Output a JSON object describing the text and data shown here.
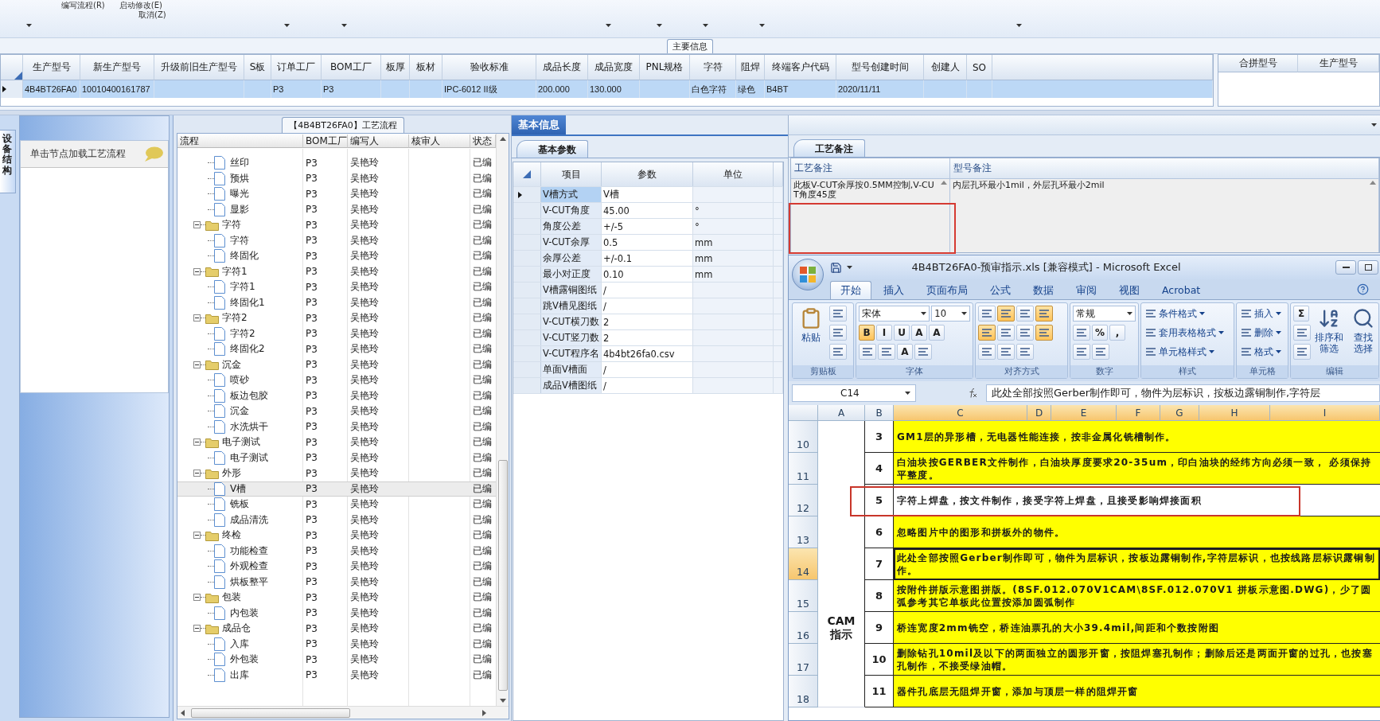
{
  "toolbar": {
    "menu_items": [
      "编写流程(R)",
      "启动修改(E)",
      "取消(Z)"
    ]
  },
  "main_info": {
    "title": "主要信息",
    "columns": [
      {
        "label": "生产型号",
        "value": "4B4BT26FA0"
      },
      {
        "label": "新生产型号",
        "value": "10010400161787"
      },
      {
        "label": "升级前旧生产型号"
      },
      {
        "label": "S板"
      },
      {
        "label": "订单工厂",
        "value": "P3"
      },
      {
        "label": "BOM工厂",
        "value": "P3"
      },
      {
        "label": "板厚"
      },
      {
        "label": "板材"
      },
      {
        "label": "验收标准",
        "value": "IPC-6012 II级"
      },
      {
        "label": "成品长度",
        "value": "200.000"
      },
      {
        "label": "成品宽度",
        "value": "130.000"
      },
      {
        "label": "PNL规格"
      },
      {
        "label": "字符",
        "value": "白色字符"
      },
      {
        "label": "阻焊",
        "value": "绿色"
      },
      {
        "label": "终端客户代码",
        "value": "B4BT"
      },
      {
        "label": "型号创建时间",
        "value": "2020/11/11"
      },
      {
        "label": "创建人"
      },
      {
        "label": "SO"
      }
    ],
    "right_columns": [
      "合拼型号",
      "生产型号"
    ]
  },
  "nav_panel": {
    "tab": "设备结构",
    "hint": "单击节点加载工艺流程"
  },
  "process_tree": {
    "title": "【4B4BT26FA0】工艺流程",
    "columns": [
      "流程",
      "BOM工厂",
      "编写人",
      "核审人",
      "状态"
    ],
    "nodes": [
      {
        "label": "丝印",
        "kind": "file",
        "bom": "P3",
        "author": "吴艳玲",
        "status": "已编",
        "selected": false
      },
      {
        "label": "预烘",
        "kind": "file",
        "bom": "P3",
        "author": "吴艳玲",
        "status": "已编",
        "selected": false
      },
      {
        "label": "曝光",
        "kind": "file",
        "bom": "P3",
        "author": "吴艳玲",
        "status": "已编",
        "selected": false
      },
      {
        "label": "显影",
        "kind": "file",
        "bom": "P3",
        "author": "吴艳玲",
        "status": "已编",
        "selected": false
      },
      {
        "label": "字符",
        "kind": "folder",
        "expanded": true,
        "bom": "P3",
        "author": "吴艳玲",
        "status": "已编",
        "selected": false,
        "children": [
          {
            "label": "字符",
            "kind": "file",
            "bom": "P3",
            "author": "吴艳玲",
            "status": "已编",
            "selected": false
          },
          {
            "label": "终固化",
            "kind": "file",
            "bom": "P3",
            "author": "吴艳玲",
            "status": "已编",
            "selected": false
          }
        ]
      },
      {
        "label": "字符1",
        "kind": "folder",
        "expanded": true,
        "bom": "P3",
        "author": "吴艳玲",
        "status": "已编",
        "selected": false,
        "children": [
          {
            "label": "字符1",
            "kind": "file",
            "bom": "P3",
            "author": "吴艳玲",
            "status": "已编",
            "selected": false
          },
          {
            "label": "终固化1",
            "kind": "file",
            "bom": "P3",
            "author": "吴艳玲",
            "status": "已编",
            "selected": false
          }
        ]
      },
      {
        "label": "字符2",
        "kind": "folder",
        "expanded": true,
        "bom": "P3",
        "author": "吴艳玲",
        "status": "已编",
        "selected": false,
        "children": [
          {
            "label": "字符2",
            "kind": "file",
            "bom": "P3",
            "author": "吴艳玲",
            "status": "已编",
            "selected": false
          },
          {
            "label": "终固化2",
            "kind": "file",
            "bom": "P3",
            "author": "吴艳玲",
            "status": "已编",
            "selected": false
          }
        ]
      },
      {
        "label": "沉金",
        "kind": "folder",
        "expanded": true,
        "bom": "P3",
        "author": "吴艳玲",
        "status": "已编",
        "selected": false,
        "children": [
          {
            "label": "喷砂",
            "kind": "file",
            "bom": "P3",
            "author": "吴艳玲",
            "status": "已编",
            "selected": false
          },
          {
            "label": "板边包胶",
            "kind": "file",
            "bom": "P3",
            "author": "吴艳玲",
            "status": "已编",
            "selected": false
          },
          {
            "label": "沉金",
            "kind": "file",
            "bom": "P3",
            "author": "吴艳玲",
            "status": "已编",
            "selected": false
          },
          {
            "label": "水洗烘干",
            "kind": "file",
            "bom": "P3",
            "author": "吴艳玲",
            "status": "已编",
            "selected": false
          }
        ]
      },
      {
        "label": "电子测试",
        "kind": "folder",
        "expanded": true,
        "bom": "P3",
        "author": "吴艳玲",
        "status": "已编",
        "selected": false,
        "children": [
          {
            "label": "电子测试",
            "kind": "file",
            "bom": "P3",
            "author": "吴艳玲",
            "status": "已编",
            "selected": false
          }
        ]
      },
      {
        "label": "外形",
        "kind": "folder",
        "expanded": true,
        "bom": "P3",
        "author": "吴艳玲",
        "status": "已编",
        "selected": false,
        "children": [
          {
            "label": "V槽",
            "kind": "file",
            "bom": "P3",
            "author": "吴艳玲",
            "status": "已编",
            "selected": true
          },
          {
            "label": "铣板",
            "kind": "file",
            "bom": "P3",
            "author": "吴艳玲",
            "status": "已编",
            "selected": false
          },
          {
            "label": "成品清洗",
            "kind": "file",
            "bom": "P3",
            "author": "吴艳玲",
            "status": "已编",
            "selected": false
          }
        ]
      },
      {
        "label": "终检",
        "kind": "folder",
        "expanded": true,
        "bom": "P3",
        "author": "吴艳玲",
        "status": "已编",
        "selected": false,
        "children": [
          {
            "label": "功能检查",
            "kind": "file",
            "bom": "P3",
            "author": "吴艳玲",
            "status": "已编",
            "selected": false
          },
          {
            "label": "外观检查",
            "kind": "file",
            "bom": "P3",
            "author": "吴艳玲",
            "status": "已编",
            "selected": false
          },
          {
            "label": "烘板整平",
            "kind": "file",
            "bom": "P3",
            "author": "吴艳玲",
            "status": "已编",
            "selected": false
          }
        ]
      },
      {
        "label": "包装",
        "kind": "folder",
        "expanded": true,
        "bom": "P3",
        "author": "吴艳玲",
        "status": "已编",
        "selected": false,
        "children": [
          {
            "label": "内包装",
            "kind": "file",
            "bom": "P3",
            "author": "吴艳玲",
            "status": "已编",
            "selected": false
          }
        ]
      },
      {
        "label": "成品仓",
        "kind": "folder",
        "expanded": true,
        "bom": "P3",
        "author": "吴艳玲",
        "status": "已编",
        "selected": false,
        "children": [
          {
            "label": "入库",
            "kind": "file",
            "bom": "P3",
            "author": "吴艳玲",
            "status": "已编",
            "selected": false
          },
          {
            "label": "外包装",
            "kind": "file",
            "bom": "P3",
            "author": "吴艳玲",
            "status": "已编",
            "selected": false
          },
          {
            "label": "出库",
            "kind": "file",
            "bom": "P3",
            "author": "吴艳玲",
            "status": "已编",
            "selected": false
          }
        ]
      }
    ]
  },
  "basic_info": {
    "tab": "基本信息",
    "subtab": "基本参数",
    "columns": [
      "项目",
      "参数",
      "单位"
    ],
    "rows": [
      {
        "item": "V槽方式",
        "param": "V槽",
        "selected": true
      },
      {
        "item": "V-CUT角度",
        "param": "45.00",
        "unit": "°",
        "selected": false
      },
      {
        "item": "角度公差",
        "param": "+/-5",
        "unit": "°",
        "selected": false
      },
      {
        "item": "V-CUT余厚",
        "param": "0.5",
        "unit": "mm",
        "selected": false
      },
      {
        "item": "余厚公差",
        "param": "+/-0.1",
        "unit": "mm",
        "selected": false
      },
      {
        "item": "最小对正度",
        "param": "0.10",
        "unit": "mm",
        "selected": false
      },
      {
        "item": "V槽露铜图纸",
        "param": "/",
        "selected": false
      },
      {
        "item": "跳V槽见图纸",
        "param": "/",
        "selected": false
      },
      {
        "item": "V-CUT横刀数",
        "param": "2",
        "selected": false
      },
      {
        "item": "V-CUT竖刀数",
        "param": "2",
        "selected": false
      },
      {
        "item": "V-CUT程序名",
        "param": "4b4bt26fa0.csv",
        "selected": false
      },
      {
        "item": "单面V槽面",
        "param": "/",
        "selected": false
      },
      {
        "item": "成品V槽图纸",
        "param": "/",
        "selected": false
      }
    ]
  },
  "process_notes": {
    "tab": "工艺备注",
    "columns": [
      "工艺备注",
      "型号备注"
    ],
    "process_note": "此板V-CUT余厚按0.5MM控制,V-CUT角度45度",
    "model_note": "内层孔环最小1mil，外层孔环最小2mil",
    "marked": true
  },
  "excel": {
    "title": "4B4BT26FA0-预审指示.xls  [兼容模式] - Microsoft Excel",
    "tabs": [
      {
        "label": "开始",
        "selected": true
      },
      {
        "label": "插入",
        "selected": false
      },
      {
        "label": "页面布局",
        "selected": false
      },
      {
        "label": "公式",
        "selected": false
      },
      {
        "label": "数据",
        "selected": false
      },
      {
        "label": "审阅",
        "selected": false
      },
      {
        "label": "视图",
        "selected": false
      },
      {
        "label": "Acrobat",
        "selected": false
      }
    ],
    "ribbon": [
      {
        "label": "剪贴板",
        "big": [
          {
            "kind": "paste",
            "lines": [
              "粘贴"
            ]
          }
        ],
        "rows": [
          {
            "items": [
              {
                "kind": "icon",
                "selected": false
              }
            ]
          },
          {
            "items": [
              {
                "kind": "icon",
                "selected": false
              }
            ]
          },
          {
            "items": [
              {
                "kind": "icon",
                "selected": false
              }
            ]
          }
        ]
      },
      {
        "label": "字体",
        "rows": [
          {
            "items": [
              {
                "kind": "combo",
                "value": "宋体"
              },
              {
                "kind": "combo",
                "value": "10"
              }
            ]
          },
          {
            "items": [
              {
                "kind": "tool",
                "text": "B",
                "selected": true
              },
              {
                "kind": "tool",
                "text": "I",
                "selected": false
              },
              {
                "kind": "tool",
                "text": "U",
                "selected": false
              },
              {
                "kind": "tool",
                "text": "A",
                "selected": false
              },
              {
                "kind": "tool",
                "text": "A",
                "selected": false
              }
            ]
          },
          {
            "items": [
              {
                "kind": "icon",
                "selected": false
              },
              {
                "kind": "icon",
                "selected": false
              },
              {
                "kind": "tool",
                "text": "A",
                "selected": false
              },
              {
                "kind": "icon",
                "selected": false
              }
            ]
          }
        ]
      },
      {
        "label": "对齐方式",
        "rows": [
          {
            "items": [
              {
                "kind": "icon",
                "selected": false
              },
              {
                "kind": "icon",
                "selected": true
              },
              {
                "kind": "icon",
                "selected": false
              },
              {
                "kind": "icon",
                "selected": true
              }
            ]
          },
          {
            "items": [
              {
                "kind": "icon",
                "selected": true
              },
              {
                "kind": "icon",
                "selected": false
              },
              {
                "kind": "icon",
                "selected": false
              },
              {
                "kind": "icon",
                "selected": true
              }
            ]
          },
          {
            "items": [
              {
                "kind": "icon",
                "selected": false
              },
              {
                "kind": "icon",
                "selected": false
              },
              {
                "kind": "icon",
                "selected": false
              }
            ]
          }
        ]
      },
      {
        "label": "数字",
        "rows": [
          {
            "items": [
              {
                "kind": "combo",
                "value": "常规"
              }
            ]
          },
          {
            "items": [
              {
                "kind": "icon",
                "selected": false
              },
              {
                "kind": "tool",
                "text": "%",
                "selected": false
              },
              {
                "kind": "tool",
                "text": ",",
                "selected": false
              }
            ]
          },
          {
            "items": [
              {
                "kind": "icon",
                "selected": false
              },
              {
                "kind": "icon",
                "selected": false
              }
            ]
          }
        ]
      },
      {
        "label": "样式",
        "rows": [
          {
            "items": [
              {
                "kind": "line",
                "label": "条件格式"
              }
            ]
          },
          {
            "items": [
              {
                "kind": "line",
                "label": "套用表格格式"
              }
            ]
          },
          {
            "items": [
              {
                "kind": "line",
                "label": "单元格样式"
              }
            ]
          }
        ]
      },
      {
        "label": "单元格",
        "rows": [
          {
            "items": [
              {
                "kind": "line",
                "label": "插入"
              }
            ]
          },
          {
            "items": [
              {
                "kind": "line",
                "label": "删除"
              }
            ]
          },
          {
            "items": [
              {
                "kind": "line",
                "label": "格式"
              }
            ]
          }
        ]
      },
      {
        "label": "编辑",
        "rows": [
          {
            "items": [
              {
                "kind": "tool",
                "text": "Σ",
                "selected": false
              }
            ]
          },
          {
            "items": [
              {
                "kind": "icon",
                "selected": false
              }
            ]
          },
          {
            "items": [
              {
                "kind": "icon",
                "selected": false
              }
            ]
          }
        ],
        "big": [
          {
            "kind": "sort",
            "lines": [
              "排序和",
              "筛选"
            ]
          },
          {
            "kind": "find",
            "lines": [
              "查找",
              "选择"
            ]
          }
        ]
      }
    ],
    "name_box": "C14",
    "formula": "此处全部按照Gerber制作即可，物件为层标识，按板边露铜制作,字符层",
    "columns": [
      {
        "label": "A",
        "selected": false
      },
      {
        "label": "B",
        "selected": false
      },
      {
        "label": "C",
        "selected": true
      },
      {
        "label": "D",
        "selected": true
      },
      {
        "label": "E",
        "selected": true
      },
      {
        "label": "F",
        "selected": true
      },
      {
        "label": "G",
        "selected": true
      },
      {
        "label": "H",
        "selected": true
      },
      {
        "label": "I",
        "selected": true
      }
    ],
    "merged_label": "CAM\n指示",
    "rows": [
      {
        "row": "10",
        "number": "3",
        "text": "GM1层的异形槽，无电器性能连接，按非金属化铣槽制作。",
        "highlight": true,
        "selected": false,
        "marked": false
      },
      {
        "row": "11",
        "number": "4",
        "text": "白油块按GERBER文件制作，白油块厚度要求20-35um，印白油块的经纬方向必须一致， 必须保持平整度。",
        "highlight": true,
        "selected": false,
        "marked": false
      },
      {
        "row": "12",
        "number": "5",
        "text": "字符上焊盘，按文件制作，接受字符上焊盘，且接受影响焊接面积",
        "highlight": false,
        "selected": false,
        "marked": true
      },
      {
        "row": "13",
        "number": "6",
        "text": "忽略图片中的图形和拼板外的物件。",
        "highlight": true,
        "selected": false,
        "marked": false
      },
      {
        "row": "14",
        "number": "7",
        "text": "此处全部按照Gerber制作即可，物件为层标识，按板边露铜制作,字符层标识，也按线路层标识露铜制作。",
        "highlight": true,
        "selected": true,
        "marked": false
      },
      {
        "row": "15",
        "number": "8",
        "text": "按附件拼版示意图拼版。(8SF.012.070V1CAM\\8SF.012.070V1 拼板示意图.DWG)，少了圆弧参考其它单板此位置按添加圆弧制作",
        "highlight": true,
        "selected": false,
        "marked": false
      },
      {
        "row": "16",
        "number": "9",
        "text": "桥连宽度2mm铣空，桥连油票孔的大小39.4mil,间距和个数按附图",
        "highlight": true,
        "selected": false,
        "marked": false
      },
      {
        "row": "17",
        "number": "10",
        "text": "删除钻孔10mil及以下的两面独立的圆形开窗，按阻焊塞孔制作；删除后还是两面开窗的过孔，也按塞孔制作，不接受绿油帽。",
        "highlight": true,
        "selected": false,
        "marked": false
      },
      {
        "row": "18",
        "number": "11",
        "text": "器件孔底层无阻焊开窗，添加与顶层一样的阻焊开窗",
        "highlight": true,
        "selected": false,
        "marked": false
      }
    ]
  }
}
